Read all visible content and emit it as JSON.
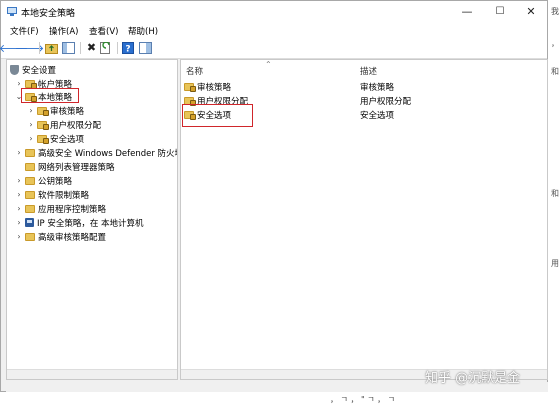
{
  "window": {
    "title": "本地安全策略"
  },
  "window_controls": {
    "minimize": "—",
    "maximize": "☐",
    "close": "✕"
  },
  "menu": [
    "文件(F)",
    "操作(A)",
    "查看(V)",
    "帮助(H)"
  ],
  "tree": {
    "root": "安全设置",
    "items": [
      {
        "label": "帐户策略"
      },
      {
        "label": "本地策略"
      },
      {
        "label": "审核策略"
      },
      {
        "label": "用户权限分配"
      },
      {
        "label": "安全选项"
      },
      {
        "label": "高级安全 Windows Defender 防火墙"
      },
      {
        "label": "网络列表管理器策略"
      },
      {
        "label": "公钥策略"
      },
      {
        "label": "软件限制策略"
      },
      {
        "label": "应用程序控制策略"
      },
      {
        "label": "IP 安全策略，在 本地计算机"
      },
      {
        "label": "高级审核策略配置"
      }
    ]
  },
  "list": {
    "columns": {
      "name": "名称",
      "desc": "描述"
    },
    "rows": [
      {
        "name": "审核策略",
        "desc": "审核策略"
      },
      {
        "name": "用户权限分配",
        "desc": "用户权限分配"
      },
      {
        "name": "安全选项",
        "desc": "安全选项"
      }
    ]
  },
  "watermark": "知乎 @沉默是金",
  "edge_chars": [
    "我",
    "，",
    "和",
    "和",
    "用"
  ],
  "below_text": "，  ㄱ  ，  \"   ㄱ  ，  ㄱ"
}
